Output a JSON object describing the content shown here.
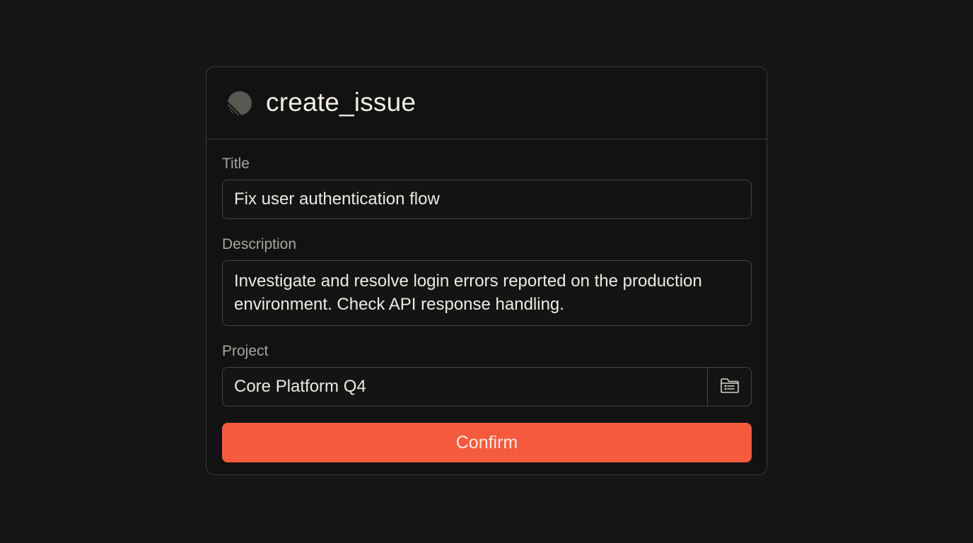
{
  "header": {
    "tool_name": "create_issue",
    "logo_icon": "linear-logo-icon"
  },
  "form": {
    "title_label": "Title",
    "title_value": "Fix user authentication flow",
    "description_label": "Description",
    "description_value": "Investigate and resolve login errors reported on the production environment. Check API response handling.",
    "project_label": "Project",
    "project_value": "Core Platform Q4",
    "project_picker_icon": "folder-list-icon",
    "confirm_label": "Confirm"
  },
  "colors": {
    "background": "#161616",
    "card": "#121212",
    "border": "#3c3b38",
    "accent": "#f45b3e",
    "text": "#eeeae2",
    "label": "#a8a59e"
  }
}
